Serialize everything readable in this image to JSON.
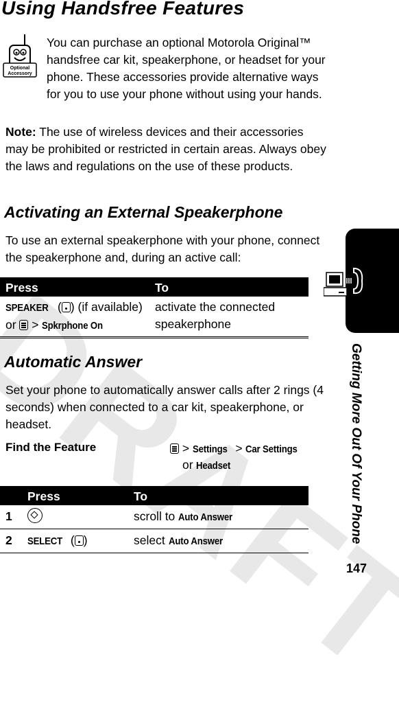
{
  "watermark": "DRAFT",
  "title": "Using Handsfree Features",
  "accessory_icon": {
    "line1": "Optional",
    "line2": "Accessory"
  },
  "intro": "You can purchase an optional Motorola Original™ handsfree car kit, speakerphone, or headset for your phone. These accessories provide alternative ways for you to use your phone without using your hands.",
  "note": {
    "label": "Note:",
    "text": " The use of wireless devices and their accessories may be prohibited or restricted in certain areas. Always obey the laws and regulations on the use of these products."
  },
  "section1": {
    "heading": "Activating an External Speakerphone",
    "body": "To use an external speakerphone with your phone, connect the speakerphone and, during an active call:",
    "table": {
      "headers": [
        "Press",
        "To"
      ],
      "row": {
        "key1": "SPEAKER",
        "mid1": " (",
        "mid2": ") (if available)",
        "or": "or ",
        "gt": " > ",
        "key2": "Spkrphone On",
        "to_line1": "activate the connected",
        "to_line2": "speakerphone"
      }
    }
  },
  "section2": {
    "heading": "Automatic Answer",
    "body": "Set your phone to automatically answer calls after 2 rings (4 seconds) when connected to a car kit, speakerphone, or headset.",
    "find": {
      "label": "Find the Feature",
      "gt": " > ",
      "item1": "Settings",
      "item2": "Car Settings",
      "or": "or ",
      "item3": "Headset"
    },
    "table": {
      "headers": [
        "",
        "Press",
        "To"
      ],
      "rows": [
        {
          "num": "1",
          "press_icon": "nav-key-icon",
          "to_text": "scroll to ",
          "to_bold": "Auto Answer"
        },
        {
          "num": "2",
          "press_key": "SELECT",
          "press_paren_open": " (",
          "press_paren_close": ")",
          "to_text": "select ",
          "to_bold": "Auto Answer"
        }
      ]
    }
  },
  "side_tab": "Getting More Out Of Your Phone",
  "page_number": "147"
}
